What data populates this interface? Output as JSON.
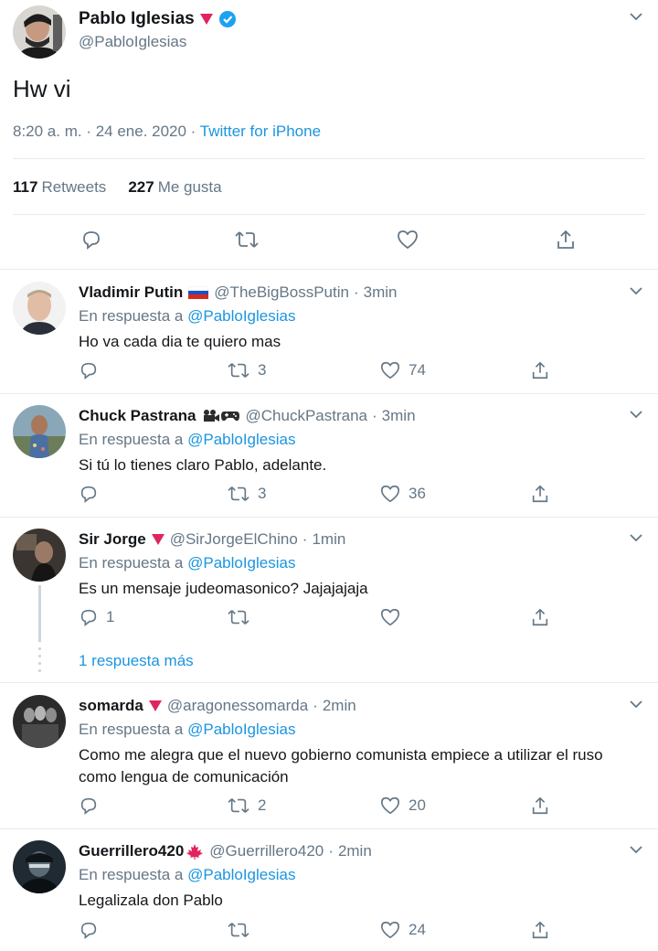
{
  "main_tweet": {
    "author_name": "Pablo Iglesias",
    "author_handle": "@PabloIglesias",
    "text": "Hw vi",
    "timestamp": "8:20 a. m. · 24 ene. 2020 · ",
    "source": "Twitter for iPhone",
    "retweets_count": "117",
    "retweets_label": "Retweets",
    "likes_count": "227",
    "likes_label": "Me gusta"
  },
  "replies_label": "En respuesta a",
  "mention": "@PabloIglesias",
  "replies": [
    {
      "name": "Vladimir Putin",
      "handle": "@TheBigBossPutin",
      "time": "3min",
      "text": "Ho va cada dia te quiero mas",
      "reply_count": "",
      "retweet_count": "3",
      "like_count": "74"
    },
    {
      "name": "Chuck Pastrana",
      "handle": "@ChuckPastrana",
      "time": "3min",
      "text": "Si tú lo tienes claro Pablo, adelante.",
      "reply_count": "",
      "retweet_count": "3",
      "like_count": "36"
    },
    {
      "name": "Sir Jorge",
      "handle": "@SirJorgeElChino",
      "time": "1min",
      "text": "Es un mensaje judeomasonico? Jajajajaja",
      "reply_count": "1",
      "retweet_count": "",
      "like_count": ""
    },
    {
      "name": "somarda",
      "handle": "@aragonessomarda",
      "time": "2min",
      "text": "Como me alegra que el nuevo gobierno comunista empiece a utilizar el ruso como lengua de comunicación",
      "reply_count": "",
      "retweet_count": "2",
      "like_count": "20"
    },
    {
      "name": "Guerrillero420",
      "handle": "@Guerrillero420",
      "time": "2min",
      "text": "Legalizala don Pablo",
      "reply_count": "",
      "retweet_count": "",
      "like_count": "24"
    }
  ],
  "more_replies_label": "1 respuesta más",
  "separator": "·",
  "icons": {
    "verified": "verified-badge-icon",
    "party": "red-triangle-icon",
    "chevron": "chevron-down-icon",
    "reply": "reply-icon",
    "retweet": "retweet-icon",
    "like": "heart-icon",
    "share": "share-icon"
  },
  "colors": {
    "link": "#1b95e0",
    "secondary_text": "#657786",
    "primary_text": "#14171a",
    "divider": "#e6ecf0",
    "triangle": "#e0245e"
  }
}
